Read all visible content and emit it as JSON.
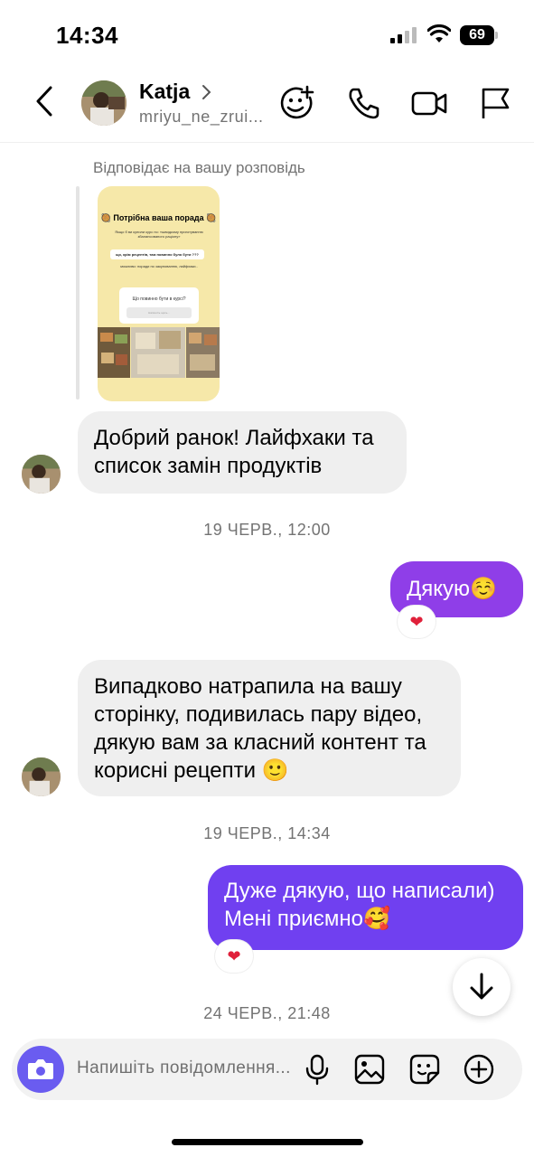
{
  "status_bar": {
    "time": "14:34",
    "battery": "69"
  },
  "header": {
    "name": "Katja",
    "username": "mriyu_ne_zrui..."
  },
  "thread": {
    "reply_note": "Відповідає на вашу розповідь",
    "story": {
      "title": "Потрібна ваша порада",
      "line1": "Якщо б ви купили курс по: «швидкому приготуванню збалансованого раціону»",
      "pill": "що, крім рецептів, там повинно було бути ???",
      "line2": "можливо: поради по закупованню, лайфхаки..",
      "question": "Що повинно бути в курсі?",
      "answer_hint": "Напишіть щось..."
    },
    "messages": [
      {
        "side": "in",
        "text": "Добрий ранок! Лайфхаки та список замін продуктів"
      },
      {
        "side": "out",
        "text": "Дякую☺️",
        "reaction": "❤"
      },
      {
        "side": "in",
        "text": "Випадково натрапила на вашу сторінку, подивилась пару відео, дякую вам за класний контент та корисні рецепти 🙂"
      },
      {
        "side": "out",
        "text": "Дуже дякую, що написали) Мені приємно🥰",
        "reaction": "❤"
      }
    ],
    "timestamps": [
      "19 ЧЕРВ., 12:00",
      "19 ЧЕРВ., 14:34",
      "24 ЧЕРВ., 21:48"
    ]
  },
  "composer": {
    "placeholder": "Напишіть повідомлення..."
  },
  "colors": {
    "outgoing_1": "#8f3ee8",
    "outgoing_2": "#7040f0",
    "incoming": "#efefef",
    "camera": "#6a5cf0",
    "heart": "#e0203a"
  },
  "icons": [
    "chevron-left-icon",
    "add-friend-face-icon",
    "phone-icon",
    "video-icon",
    "flag-icon",
    "camera-icon",
    "microphone-icon",
    "image-icon",
    "sticker-icon",
    "plus-circle-icon",
    "arrow-down-icon"
  ]
}
